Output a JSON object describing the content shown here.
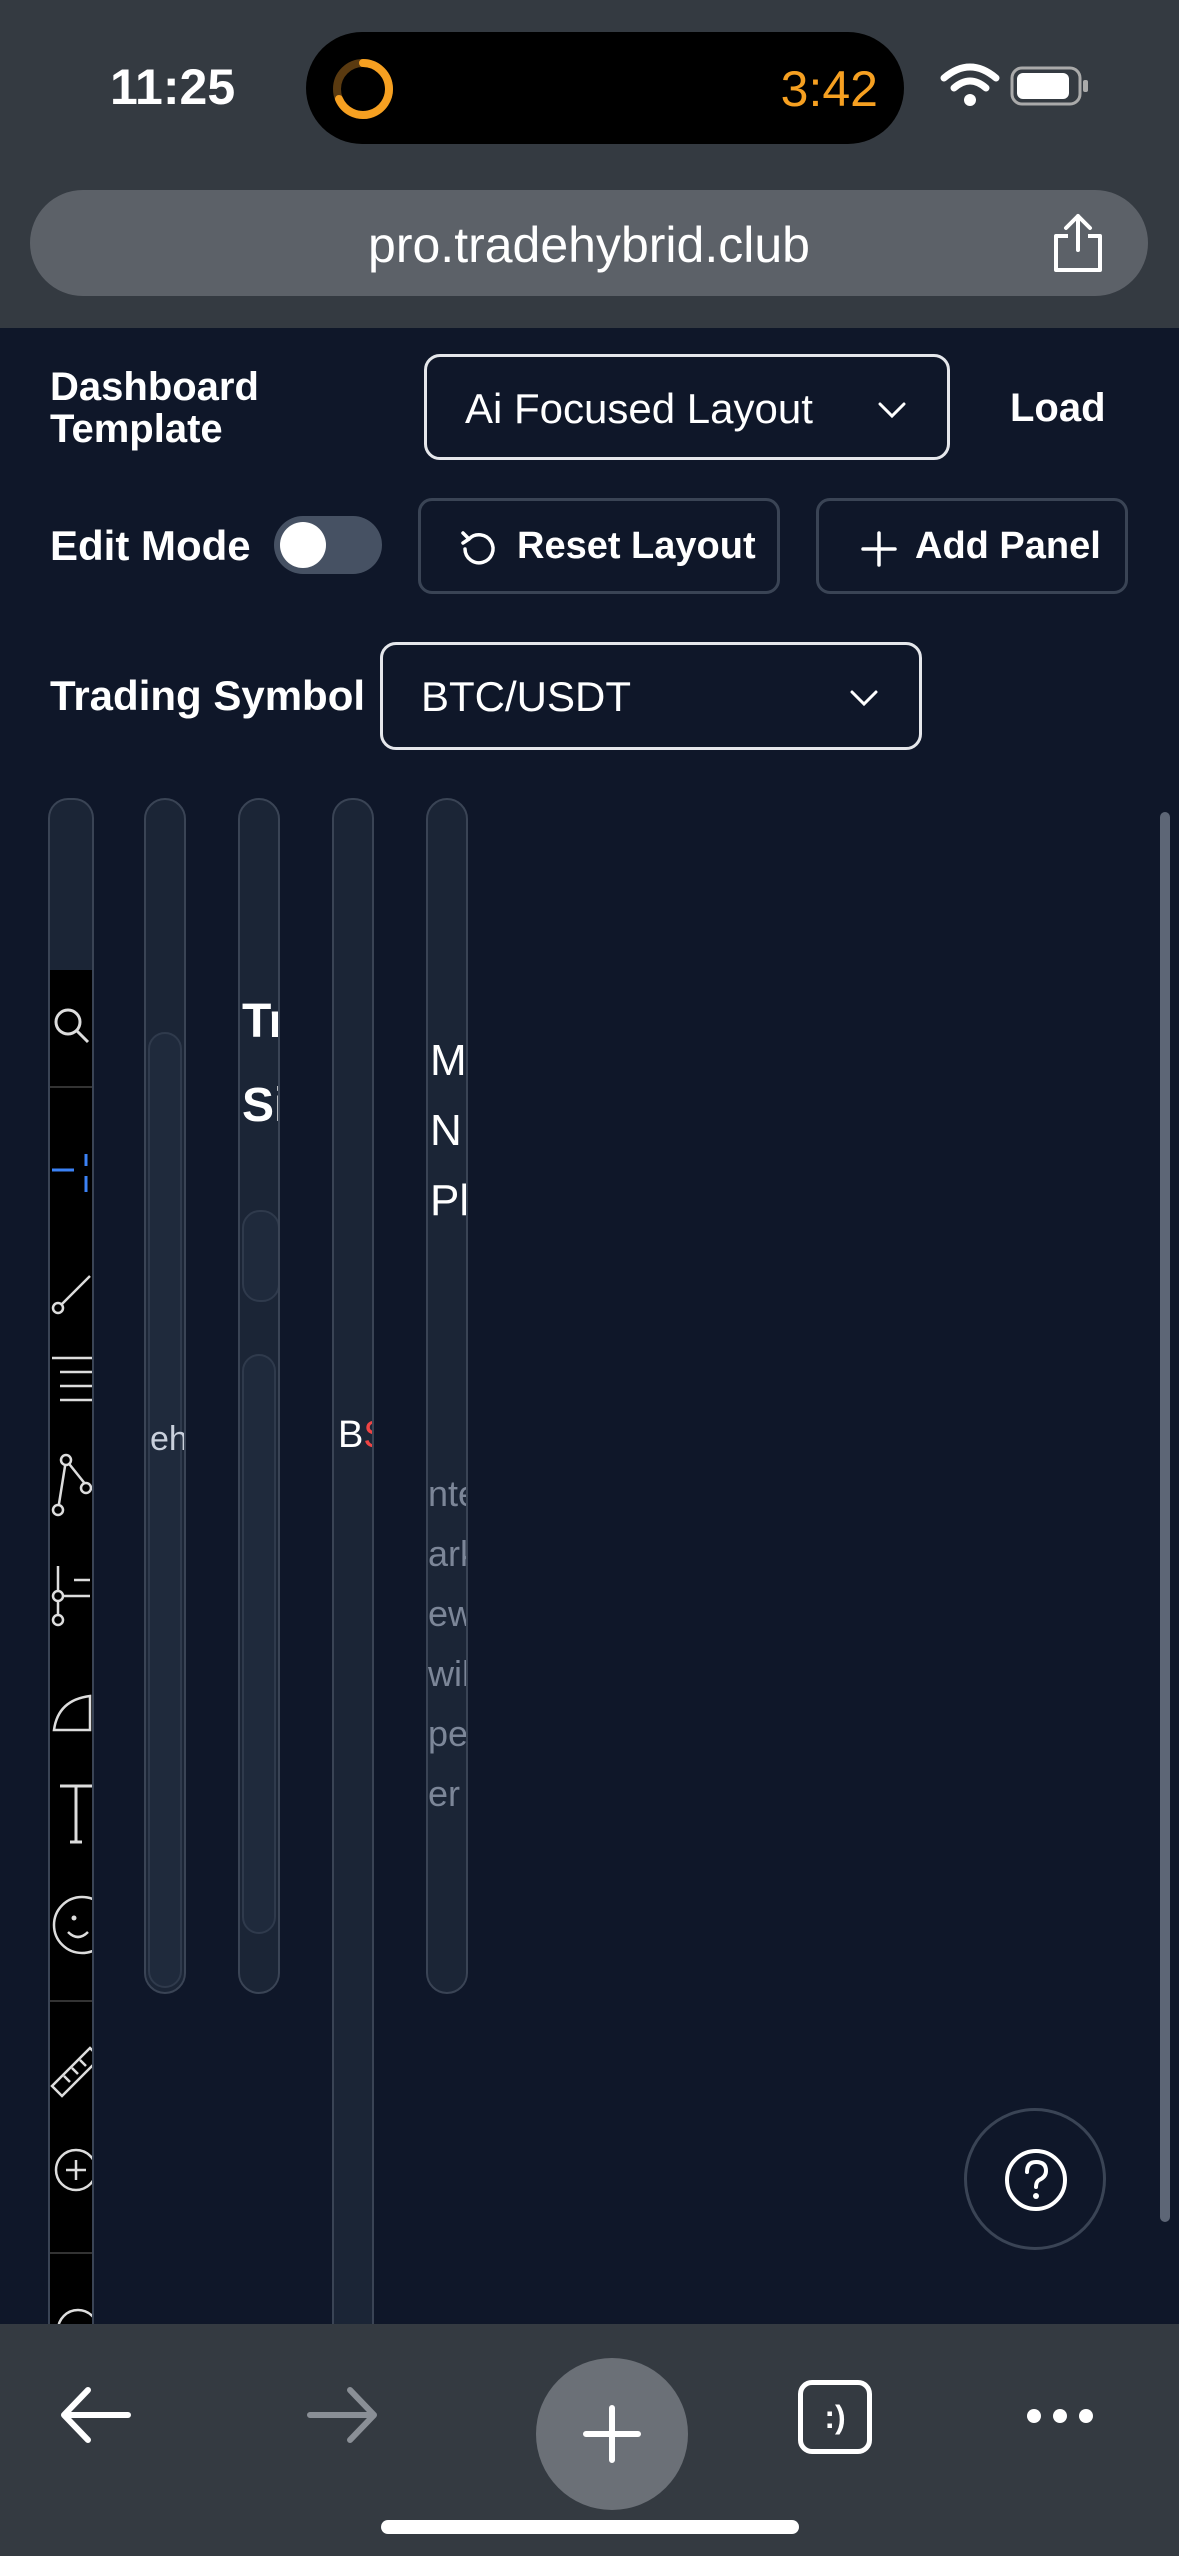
{
  "status_bar": {
    "time": "11:25",
    "timer": "3:42"
  },
  "browser": {
    "url": "pro.tradehybrid.club"
  },
  "controls": {
    "dashboard_template_label_1": "Dashboard",
    "dashboard_template_label_2": "Template",
    "template_value": "Ai Focused Layout",
    "load_label": "Load",
    "edit_mode_label": "Edit Mode",
    "edit_mode_on": false,
    "reset_layout_label": "Reset Layout",
    "add_panel_label": "Add Panel",
    "trading_symbol_label": "Trading Symbol",
    "trading_symbol_value": "BTC/USDT"
  },
  "panels": {
    "p2_text": "eh",
    "p3_title_1": "Tr",
    "p3_title_2": "Si",
    "p4_text": "B",
    "p5_title_1": "M",
    "p5_title_2": "N",
    "p5_title_3": "Pl",
    "p5_body": [
      "nte",
      "ark",
      "ew",
      "wil",
      "pe",
      "er"
    ]
  },
  "colors": {
    "background": "#0f1729",
    "chrome": "#343a41",
    "timer": "#f6a021",
    "accent": "#3b82f6"
  }
}
